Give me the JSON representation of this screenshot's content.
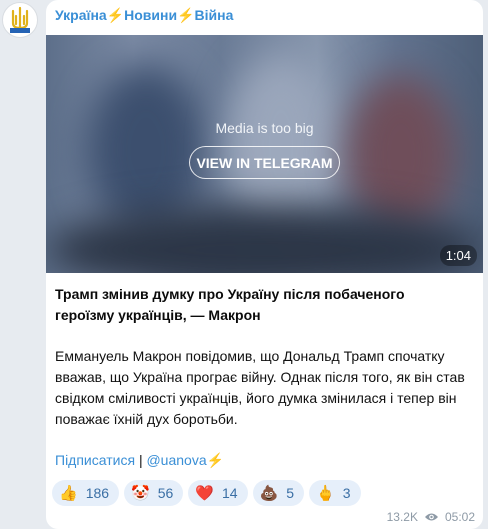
{
  "channel": {
    "title": "Україна⚡Новини⚡Війна",
    "avatar_icon": "trident-emblem-icon"
  },
  "media": {
    "overlay_text": "Media is too big",
    "button_label": "VIEW IN TELEGRAM",
    "duration": "1:04"
  },
  "post": {
    "title": "Трамп змінив думку про Україну після побаченого героїзму українців, — Макрон",
    "body": "Еммануель Макрон повідомив, що Дональд Трамп спочатку вважав, що Україна програє війну. Однак після того, як він став свідком сміливості українців, його думка змінилася і тепер він поважає їхній дух боротьби.",
    "subscribe_label": "Підписатися",
    "separator": "|",
    "handle": "@uanova⚡"
  },
  "reactions": [
    {
      "emoji": "👍",
      "count": "186"
    },
    {
      "emoji": "🤡",
      "count": "56"
    },
    {
      "emoji": "❤️",
      "count": "14"
    },
    {
      "emoji": "💩",
      "count": "5"
    },
    {
      "emoji": "🖕",
      "count": "3"
    }
  ],
  "meta": {
    "views": "13.2K",
    "time": "05:02",
    "views_icon": "eye-icon"
  },
  "colors": {
    "accent": "#3a8fd6",
    "reaction_bg": "#e6effa",
    "page_bg": "#e7ebf0"
  }
}
